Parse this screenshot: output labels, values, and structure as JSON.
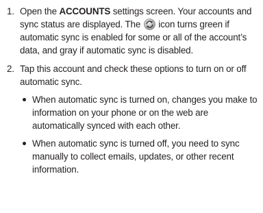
{
  "steps": [
    {
      "number": "1.",
      "text_before": "Open the ",
      "bold": "ACCOUNTS",
      "text_mid": " settings screen. Your accounts and sync status are displayed. The ",
      "icon": "sync-icon",
      "text_after": " icon turns green if automatic sync is enabled for some or all of the account’s data, and gray if automatic sync is disabled."
    },
    {
      "number": "2.",
      "text": "Tap this account and check these options to turn on or off automatic sync.",
      "bullets": [
        "When automatic sync is turned on, changes you make to information on your phone or on the web are automatically synced with each other.",
        "When automatic sync is turned off, you need to sync manually to collect emails, updates, or other recent information."
      ]
    }
  ]
}
